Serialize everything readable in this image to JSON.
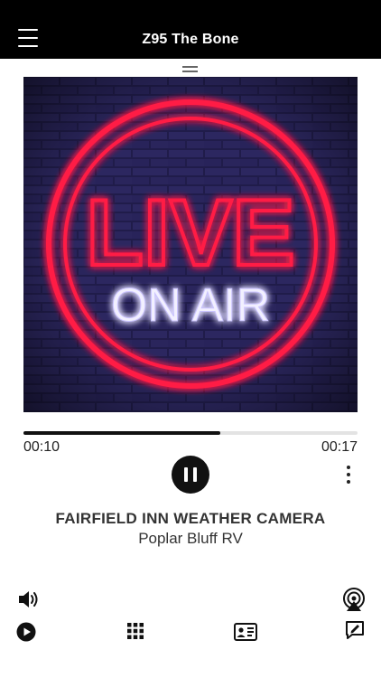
{
  "header": {
    "title": "Z95 The Bone"
  },
  "artwork": {
    "line1": "LIVE",
    "line2": "ON AIR"
  },
  "player": {
    "current_time": "00:10",
    "duration": "00:17",
    "progress": 0.59
  },
  "track": {
    "title": "FAIRFIELD INN WEATHER CAMERA",
    "subtitle": "Poplar Bluff RV"
  },
  "icons": {
    "menu": "hamburger-menu-icon",
    "pause": "pause-icon",
    "more": "more-vertical-icon",
    "volume": "speaker-icon",
    "airplay": "airplay-icon",
    "play_tab": "play-circle-icon",
    "grid_tab": "grid-icon",
    "contact_tab": "contact-card-icon",
    "edit_tab": "edit-message-icon"
  },
  "colors": {
    "header_bg": "#000000",
    "neon_red": "#ff1e44",
    "neon_white": "#f2f0ff"
  }
}
